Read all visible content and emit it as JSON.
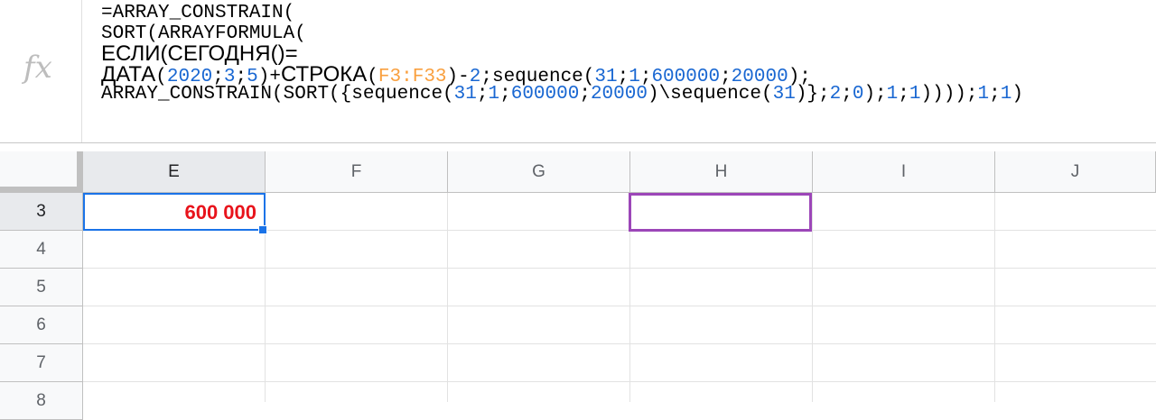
{
  "formula_bar": {
    "icon": "fx-icon",
    "icon_label": "fx",
    "lines": [
      {
        "class": "fl",
        "tokens": [
          {
            "t": "=ARRAY_CONSTRAIN("
          }
        ]
      },
      {
        "class": "fl",
        "tokens": [
          {
            "t": "SORT(ARRAYFORMULA("
          }
        ]
      },
      {
        "class": "fl cyr",
        "tokens": [
          {
            "t": "ЕСЛИ(СЕГОДНЯ()="
          }
        ]
      },
      {
        "class": "fl",
        "tokens": [
          {
            "t": "ДАТА",
            "c": "cyr"
          },
          {
            "t": "("
          },
          {
            "t": "2020",
            "c": "tok-num"
          },
          {
            "t": ";"
          },
          {
            "t": "3",
            "c": "tok-num"
          },
          {
            "t": ";"
          },
          {
            "t": "5",
            "c": "tok-num"
          },
          {
            "t": ")+"
          },
          {
            "t": "СТРОКА",
            "c": "cyr"
          },
          {
            "t": "("
          },
          {
            "t": "F3:F33",
            "c": "tok-ref"
          },
          {
            "t": ")-"
          },
          {
            "t": "2",
            "c": "tok-num"
          },
          {
            "t": ";sequence("
          },
          {
            "t": "31",
            "c": "tok-num"
          },
          {
            "t": ";"
          },
          {
            "t": "1",
            "c": "tok-num"
          },
          {
            "t": ";"
          },
          {
            "t": "600000",
            "c": "tok-num"
          },
          {
            "t": ";"
          },
          {
            "t": "20000",
            "c": "tok-num"
          },
          {
            "t": ");"
          }
        ]
      },
      {
        "class": "fl",
        "tokens": [
          {
            "t": "ARRAY_CONSTRAIN(SORT({sequence("
          },
          {
            "t": "31",
            "c": "tok-num"
          },
          {
            "t": ";"
          },
          {
            "t": "1",
            "c": "tok-num"
          },
          {
            "t": ";"
          },
          {
            "t": "600000",
            "c": "tok-num"
          },
          {
            "t": ";"
          },
          {
            "t": "20000",
            "c": "tok-num"
          },
          {
            "t": ")\\sequence("
          },
          {
            "t": "31",
            "c": "tok-num"
          },
          {
            "t": ")};"
          },
          {
            "t": "2",
            "c": "tok-num"
          },
          {
            "t": ";"
          },
          {
            "t": "0",
            "c": "tok-num"
          },
          {
            "t": ");"
          },
          {
            "t": "1",
            "c": "tok-num"
          },
          {
            "t": ";"
          },
          {
            "t": "1",
            "c": "tok-num"
          },
          {
            "t": "))));"
          },
          {
            "t": "1",
            "c": "tok-num"
          },
          {
            "t": ";"
          },
          {
            "t": "1",
            "c": "tok-num"
          },
          {
            "t": ")"
          }
        ]
      }
    ]
  },
  "columns": [
    "E",
    "F",
    "G",
    "H",
    "I",
    "J"
  ],
  "selected_column": "E",
  "rows": [
    "3",
    "4",
    "5",
    "6",
    "7",
    "8"
  ],
  "selected_row": "3",
  "cells": {
    "E3": "600 000"
  },
  "colors": {
    "selection_border": "#1a73e8",
    "collaborator_cursor": "#9c46b8",
    "value_text": "#e8131b",
    "number_token": "#1967d2",
    "range_token": "#f9a03f"
  }
}
